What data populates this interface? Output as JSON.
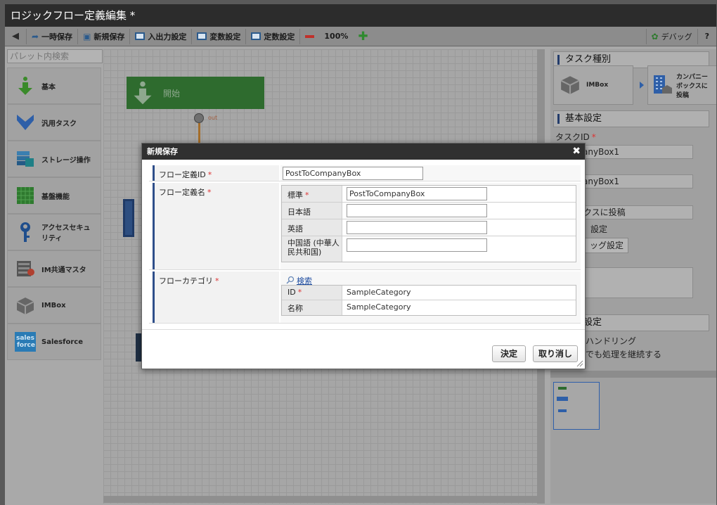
{
  "window": {
    "title": "ロジックフロー定義編集 *"
  },
  "toolbar": {
    "temp_save": "一時保存",
    "new_save": "新規保存",
    "io_settings": "入出力設定",
    "var_settings": "変数設定",
    "const_settings": "定数設定",
    "zoom": "100%",
    "debug": "デバッグ",
    "help": "?"
  },
  "palette": {
    "search_placeholder": "パレット内検索",
    "items": [
      {
        "label": "基本",
        "icon": "arrow-down-icon"
      },
      {
        "label": "汎用タスク",
        "icon": "arrow-down-blue-icon"
      },
      {
        "label": "ストレージ操作",
        "icon": "storage-icon"
      },
      {
        "label": "基盤機能",
        "icon": "grid-icon"
      },
      {
        "label": "アクセスセキュリティ",
        "icon": "key-icon"
      },
      {
        "label": "IM共通マスタ",
        "icon": "database-icon"
      },
      {
        "label": "IMBox",
        "icon": "box-icon"
      },
      {
        "label": "Salesforce",
        "icon": "salesforce-icon"
      }
    ]
  },
  "canvas": {
    "start_node": "開始",
    "out_label": "out"
  },
  "right_panel": {
    "task_type_header": "タスク種別",
    "task_card_1": "IMBox",
    "task_card_2": "カンパニーボックスに投稿",
    "basic_settings_header": "基本設定",
    "task_id_label": "タスクID",
    "task_id_value": "CompanyBox1",
    "task_name_value": "CompanyBox1",
    "display_name_value": "ーボックスに投稿",
    "settings_label": "設定",
    "settings_button": "ッグ設定",
    "specific_settings_header": "固有設定",
    "handling_label": "ハンドリング",
    "continue_label": "でも処理を継続する"
  },
  "dialog": {
    "title": "新規保存",
    "flow_id_label": "フロー定義ID",
    "flow_id_value": "PostToCompanyBox",
    "flow_name_label": "フロー定義名",
    "name_rows": [
      {
        "label": "標準",
        "required": true,
        "value": "PostToCompanyBox"
      },
      {
        "label": "日本語",
        "required": false,
        "value": ""
      },
      {
        "label": "英語",
        "required": false,
        "value": ""
      },
      {
        "label": "中国語 (中華人民共和国)",
        "required": false,
        "value": ""
      }
    ],
    "category_label": "フローカテゴリ",
    "search_link": "検索",
    "category_rows": [
      {
        "label": "ID",
        "required": true,
        "value": "SampleCategory"
      },
      {
        "label": "名称",
        "required": false,
        "value": "SampleCategory"
      }
    ],
    "ok_button": "決定",
    "cancel_button": "取り消し",
    "required_mark": "*"
  }
}
